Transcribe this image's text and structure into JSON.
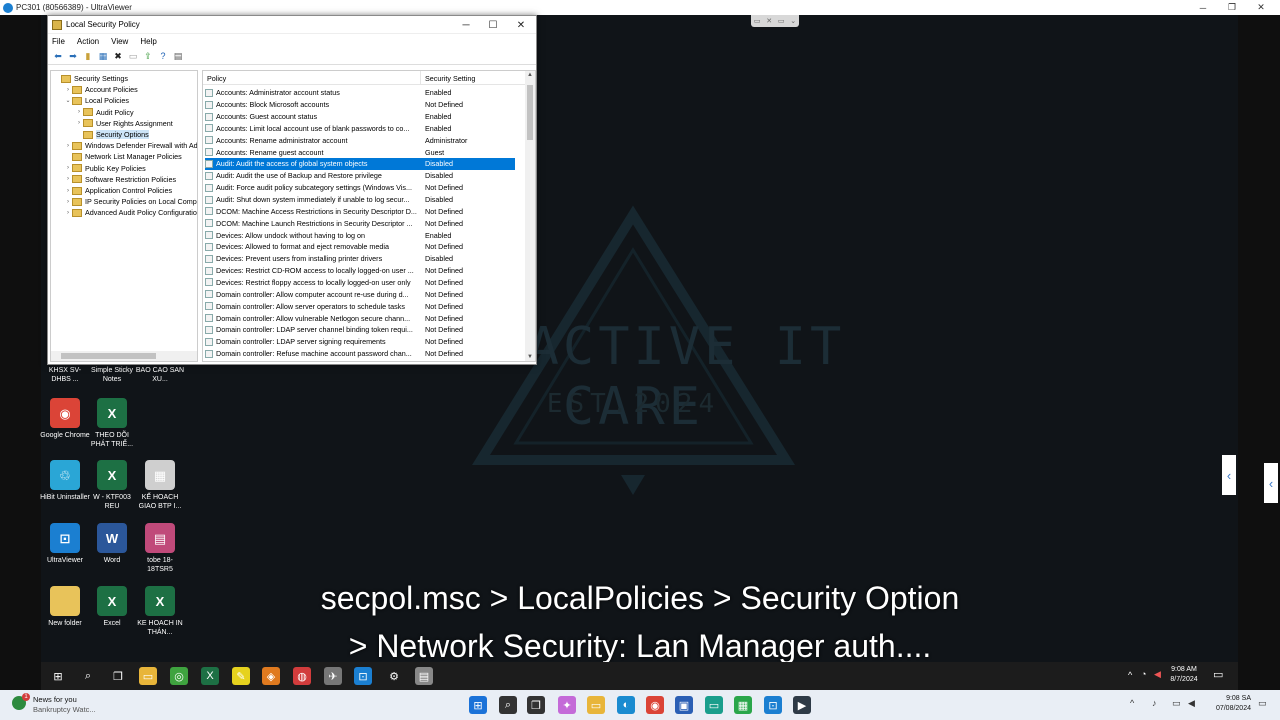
{
  "uv_window": {
    "title": "PC301 (80566389) - UltraViewer",
    "minimize": "─",
    "restore": "❐",
    "close": "✕"
  },
  "remote_toolbar": {
    "icon1": "▭",
    "icon2": "✕",
    "icon3": "▭",
    "icon4": "⌄"
  },
  "lsp": {
    "title": "Local Security Policy",
    "menu": [
      "File",
      "Action",
      "View",
      "Help"
    ],
    "tree": [
      {
        "label": "Security Settings",
        "indent": 0,
        "exp": ""
      },
      {
        "label": "Account Policies",
        "indent": 1,
        "exp": "›"
      },
      {
        "label": "Local Policies",
        "indent": 1,
        "exp": "⌄"
      },
      {
        "label": "Audit Policy",
        "indent": 2,
        "exp": "›"
      },
      {
        "label": "User Rights Assignment",
        "indent": 2,
        "exp": "›"
      },
      {
        "label": "Security Options",
        "indent": 2,
        "exp": "",
        "selected": true
      },
      {
        "label": "Windows Defender Firewall with Adva",
        "indent": 1,
        "exp": "›"
      },
      {
        "label": "Network List Manager Policies",
        "indent": 1,
        "exp": ""
      },
      {
        "label": "Public Key Policies",
        "indent": 1,
        "exp": "›"
      },
      {
        "label": "Software Restriction Policies",
        "indent": 1,
        "exp": "›"
      },
      {
        "label": "Application Control Policies",
        "indent": 1,
        "exp": "›"
      },
      {
        "label": "IP Security Policies on Local Compute",
        "indent": 1,
        "exp": "›"
      },
      {
        "label": "Advanced Audit Policy Configuration",
        "indent": 1,
        "exp": "›"
      }
    ],
    "list_headers": {
      "policy": "Policy",
      "setting": "Security Setting"
    },
    "rows": [
      {
        "policy": "Accounts: Administrator account status",
        "setting": "Enabled"
      },
      {
        "policy": "Accounts: Block Microsoft accounts",
        "setting": "Not Defined"
      },
      {
        "policy": "Accounts: Guest account status",
        "setting": "Enabled"
      },
      {
        "policy": "Accounts: Limit local account use of blank passwords to co...",
        "setting": "Enabled"
      },
      {
        "policy": "Accounts: Rename administrator account",
        "setting": "Administrator"
      },
      {
        "policy": "Accounts: Rename guest account",
        "setting": "Guest"
      },
      {
        "policy": "Audit: Audit the access of global system objects",
        "setting": "Disabled",
        "selected": true
      },
      {
        "policy": "Audit: Audit the use of Backup and Restore privilege",
        "setting": "Disabled"
      },
      {
        "policy": "Audit: Force audit policy subcategory settings (Windows Vis...",
        "setting": "Not Defined"
      },
      {
        "policy": "Audit: Shut down system immediately if unable to log secur...",
        "setting": "Disabled"
      },
      {
        "policy": "DCOM: Machine Access Restrictions in Security Descriptor D...",
        "setting": "Not Defined"
      },
      {
        "policy": "DCOM: Machine Launch Restrictions in Security Descriptor ...",
        "setting": "Not Defined"
      },
      {
        "policy": "Devices: Allow undock without having to log on",
        "setting": "Enabled"
      },
      {
        "policy": "Devices: Allowed to format and eject removable media",
        "setting": "Not Defined"
      },
      {
        "policy": "Devices: Prevent users from installing printer drivers",
        "setting": "Disabled"
      },
      {
        "policy": "Devices: Restrict CD-ROM access to locally logged-on user ...",
        "setting": "Not Defined"
      },
      {
        "policy": "Devices: Restrict floppy access to locally logged-on user only",
        "setting": "Not Defined"
      },
      {
        "policy": "Domain controller: Allow computer account re-use during d...",
        "setting": "Not Defined"
      },
      {
        "policy": "Domain controller: Allow server operators to schedule tasks",
        "setting": "Not Defined"
      },
      {
        "policy": "Domain controller: Allow vulnerable Netlogon secure chann...",
        "setting": "Not Defined"
      },
      {
        "policy": "Domain controller: LDAP server channel binding token requi...",
        "setting": "Not Defined"
      },
      {
        "policy": "Domain controller: LDAP server signing requirements",
        "setting": "Not Defined"
      },
      {
        "policy": "Domain controller: Refuse machine account password chan...",
        "setting": "Not Defined"
      }
    ]
  },
  "watermark": {
    "text": "PROACTIVE IT CARE",
    "sub": "EST.2024"
  },
  "desktop_icons": [
    {
      "label": "KHSX SV-DHBS ...",
      "glyph": "",
      "color": "#101418"
    },
    {
      "label": "Simple Sticky Notes",
      "glyph": "",
      "color": "#101418"
    },
    {
      "label": "BAO CAO SAN XU...",
      "glyph": "",
      "color": "#101418"
    },
    {
      "label": "Google Chrome",
      "glyph": "◉",
      "color": "#db4437"
    },
    {
      "label": "THEO DÕI PHÁT TRIỂ...",
      "glyph": "X",
      "color": "#1d7044"
    },
    {
      "label": "HiBit Uninstaller",
      "glyph": "♲",
      "color": "#2aa6d6"
    },
    {
      "label": "W - KTF003 REU",
      "glyph": "X",
      "color": "#1d7044"
    },
    {
      "label": "KẾ HOACH GIAO BTP I...",
      "glyph": "▦",
      "color": "#cfcfcf"
    },
    {
      "label": "UltraViewer",
      "glyph": "⊡",
      "color": "#1b7fd1"
    },
    {
      "label": "Word",
      "glyph": "W",
      "color": "#2b579a"
    },
    {
      "label": "tobe 18-18TSR5",
      "glyph": "▤",
      "color": "#c04a7a"
    },
    {
      "label": "New folder",
      "glyph": "",
      "color": "#e8c35a"
    },
    {
      "label": "Excel",
      "glyph": "X",
      "color": "#1d7044"
    },
    {
      "label": "KE HOACH IN THÁN...",
      "glyph": "X",
      "color": "#1d7044"
    }
  ],
  "subtitle": {
    "line1": "secpol.msc > LocalPolicies > Security Option",
    "line2": "> Network Security: Lan Manager auth...."
  },
  "remote_taskbar": {
    "time": "9:08 AM",
    "date": "8/7/2024",
    "icons": [
      {
        "name": "start-icon",
        "glyph": "⊞",
        "color": "#1c1c1c"
      },
      {
        "name": "search-icon",
        "glyph": "⌕",
        "color": "#1c1c1c"
      },
      {
        "name": "task-view-icon",
        "glyph": "❐",
        "color": "#1c1c1c"
      },
      {
        "name": "file-explorer-icon",
        "glyph": "▭",
        "color": "#e8b53a"
      },
      {
        "name": "app-green-icon",
        "glyph": "◎",
        "color": "#3fa33f"
      },
      {
        "name": "excel-icon",
        "glyph": "X",
        "color": "#1d7044"
      },
      {
        "name": "sticky-notes-icon",
        "glyph": "✎",
        "color": "#e6d21e"
      },
      {
        "name": "app-orange-icon",
        "glyph": "◈",
        "color": "#e07a1f"
      },
      {
        "name": "chat-icon",
        "glyph": "◍",
        "color": "#d23c3c"
      },
      {
        "name": "app-bird-icon",
        "glyph": "✈",
        "color": "#777"
      },
      {
        "name": "ultraviewer-taskbar-icon",
        "glyph": "⊡",
        "color": "#1b7fd1"
      },
      {
        "name": "settings-icon",
        "glyph": "⚙",
        "color": "#1c1c1c"
      },
      {
        "name": "security-policy-taskbar-icon",
        "glyph": "▤",
        "color": "#888"
      }
    ]
  },
  "local_taskbar": {
    "news_title": "News for you",
    "news_sub": "Bankruptcy Watc...",
    "news_badge": "1",
    "time": "9:08 SA",
    "date": "07/08/2024",
    "icons": [
      {
        "name": "start-icon",
        "glyph": "⊞",
        "color": "#1b72d8"
      },
      {
        "name": "search-icon",
        "glyph": "⌕",
        "color": "#333"
      },
      {
        "name": "task-view-icon",
        "glyph": "❐",
        "color": "#333"
      },
      {
        "name": "copilot-icon",
        "glyph": "✦",
        "color": "#c46ad8"
      },
      {
        "name": "file-explorer-icon",
        "glyph": "▭",
        "color": "#e8b53a"
      },
      {
        "name": "edge-icon",
        "glyph": "◐",
        "color": "#1a8bd0"
      },
      {
        "name": "chrome-icon",
        "glyph": "◉",
        "color": "#db4437"
      },
      {
        "name": "store-icon",
        "glyph": "▣",
        "color": "#2b5fb4"
      },
      {
        "name": "app-teal-icon",
        "glyph": "▭",
        "color": "#1a9e8c"
      },
      {
        "name": "app-green-icon",
        "glyph": "▦",
        "color": "#2aa64a"
      },
      {
        "name": "ultraviewer-taskbar-icon",
        "glyph": "⊡",
        "color": "#1b7fd1"
      },
      {
        "name": "terminal-icon",
        "glyph": "▶",
        "color": "#2e3a46"
      }
    ]
  }
}
